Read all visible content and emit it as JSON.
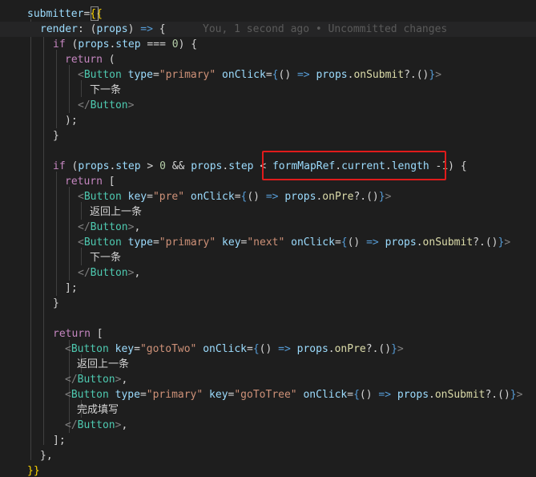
{
  "colors": {
    "background": "#1e1e1e",
    "text": "#d4d4d4",
    "property": "#9cdcfe",
    "keyword": "#c586c0",
    "storage": "#569cd6",
    "tag": "#4ec9b0",
    "tag_bracket": "#808080",
    "string": "#ce9178",
    "number": "#b5cea8",
    "function": "#dcdcaa",
    "brace": "#ffd700",
    "blame": "#5a5a5a",
    "annotation_box": "#e01b1b"
  },
  "editor": {
    "blame_annotation": "You, 1 second ago • Uncommitted changes",
    "lines": [
      [
        [
          "submitter",
          "p"
        ],
        [
          "=",
          "t"
        ],
        [
          "{",
          "g"
        ],
        [
          "{",
          "g"
        ]
      ],
      [
        [
          "render",
          "p"
        ],
        [
          ": (",
          "t"
        ],
        [
          "props",
          "p"
        ],
        [
          ") ",
          "t"
        ],
        [
          "=>",
          "s"
        ],
        [
          " {",
          "t"
        ]
      ],
      [
        [
          "if",
          "k"
        ],
        [
          " (",
          "t"
        ],
        [
          "props",
          "p"
        ],
        [
          ".",
          "t"
        ],
        [
          "step",
          "p"
        ],
        [
          " === ",
          "t"
        ],
        [
          "0",
          "n"
        ],
        [
          ") {",
          "t"
        ]
      ],
      [
        [
          "return",
          "k"
        ],
        [
          " (",
          "t"
        ]
      ],
      [
        [
          "<",
          "b"
        ],
        [
          "Button",
          "c"
        ],
        [
          " ",
          "t"
        ],
        [
          "type",
          "p"
        ],
        [
          "=",
          "t"
        ],
        [
          "\"primary\"",
          "r"
        ],
        [
          " ",
          "t"
        ],
        [
          "onClick",
          "p"
        ],
        [
          "=",
          "t"
        ],
        [
          "{",
          "s"
        ],
        [
          "() ",
          "t"
        ],
        [
          "=>",
          "s"
        ],
        [
          " ",
          "t"
        ],
        [
          "props",
          "p"
        ],
        [
          ".",
          "t"
        ],
        [
          "onSubmit",
          "f"
        ],
        [
          "?.()",
          "t"
        ],
        [
          "}",
          "s"
        ],
        [
          ">",
          "b"
        ]
      ],
      [
        [
          "下一条",
          "t"
        ]
      ],
      [
        [
          "</",
          "b"
        ],
        [
          "Button",
          "c"
        ],
        [
          ">",
          "b"
        ]
      ],
      [
        [
          ");",
          "t"
        ]
      ],
      [
        [
          "}",
          "t"
        ]
      ],
      [],
      [
        [
          "if",
          "k"
        ],
        [
          " (",
          "t"
        ],
        [
          "props",
          "p"
        ],
        [
          ".",
          "t"
        ],
        [
          "step",
          "p"
        ],
        [
          " > ",
          "t"
        ],
        [
          "0",
          "n"
        ],
        [
          " && ",
          "t"
        ],
        [
          "props",
          "p"
        ],
        [
          ".",
          "t"
        ],
        [
          "step",
          "p"
        ],
        [
          " < ",
          "t"
        ],
        [
          "formMapRef",
          "p"
        ],
        [
          ".",
          "t"
        ],
        [
          "current",
          "p"
        ],
        [
          ".",
          "t"
        ],
        [
          "length",
          "p"
        ],
        [
          " -",
          "t"
        ],
        [
          "1",
          "n"
        ],
        [
          ") {",
          "t"
        ]
      ],
      [
        [
          "return",
          "k"
        ],
        [
          " [",
          "t"
        ]
      ],
      [
        [
          "<",
          "b"
        ],
        [
          "Button",
          "c"
        ],
        [
          " ",
          "t"
        ],
        [
          "key",
          "p"
        ],
        [
          "=",
          "t"
        ],
        [
          "\"pre\"",
          "r"
        ],
        [
          " ",
          "t"
        ],
        [
          "onClick",
          "p"
        ],
        [
          "=",
          "t"
        ],
        [
          "{",
          "s"
        ],
        [
          "() ",
          "t"
        ],
        [
          "=>",
          "s"
        ],
        [
          " ",
          "t"
        ],
        [
          "props",
          "p"
        ],
        [
          ".",
          "t"
        ],
        [
          "onPre",
          "f"
        ],
        [
          "?.()",
          "t"
        ],
        [
          "}",
          "s"
        ],
        [
          ">",
          "b"
        ]
      ],
      [
        [
          "返回上一条",
          "t"
        ]
      ],
      [
        [
          "</",
          "b"
        ],
        [
          "Button",
          "c"
        ],
        [
          ">",
          "b"
        ],
        [
          ",",
          "t"
        ]
      ],
      [
        [
          "<",
          "b"
        ],
        [
          "Button",
          "c"
        ],
        [
          " ",
          "t"
        ],
        [
          "type",
          "p"
        ],
        [
          "=",
          "t"
        ],
        [
          "\"primary\"",
          "r"
        ],
        [
          " ",
          "t"
        ],
        [
          "key",
          "p"
        ],
        [
          "=",
          "t"
        ],
        [
          "\"next\"",
          "r"
        ],
        [
          " ",
          "t"
        ],
        [
          "onClick",
          "p"
        ],
        [
          "=",
          "t"
        ],
        [
          "{",
          "s"
        ],
        [
          "() ",
          "t"
        ],
        [
          "=>",
          "s"
        ],
        [
          " ",
          "t"
        ],
        [
          "props",
          "p"
        ],
        [
          ".",
          "t"
        ],
        [
          "onSubmit",
          "f"
        ],
        [
          "?.()",
          "t"
        ],
        [
          "}",
          "s"
        ],
        [
          ">",
          "b"
        ]
      ],
      [
        [
          "下一条",
          "t"
        ]
      ],
      [
        [
          "</",
          "b"
        ],
        [
          "Button",
          "c"
        ],
        [
          ">",
          "b"
        ],
        [
          ",",
          "t"
        ]
      ],
      [
        [
          "];",
          "t"
        ]
      ],
      [
        [
          "}",
          "t"
        ]
      ],
      [],
      [
        [
          "return",
          "k"
        ],
        [
          " [",
          "t"
        ]
      ],
      [
        [
          "<",
          "b"
        ],
        [
          "Button",
          "c"
        ],
        [
          " ",
          "t"
        ],
        [
          "key",
          "p"
        ],
        [
          "=",
          "t"
        ],
        [
          "\"gotoTwo\"",
          "r"
        ],
        [
          " ",
          "t"
        ],
        [
          "onClick",
          "p"
        ],
        [
          "=",
          "t"
        ],
        [
          "{",
          "s"
        ],
        [
          "() ",
          "t"
        ],
        [
          "=>",
          "s"
        ],
        [
          " ",
          "t"
        ],
        [
          "props",
          "p"
        ],
        [
          ".",
          "t"
        ],
        [
          "onPre",
          "f"
        ],
        [
          "?.()",
          "t"
        ],
        [
          "}",
          "s"
        ],
        [
          ">",
          "b"
        ]
      ],
      [
        [
          "返回上一条",
          "t"
        ]
      ],
      [
        [
          "</",
          "b"
        ],
        [
          "Button",
          "c"
        ],
        [
          ">",
          "b"
        ],
        [
          ",",
          "t"
        ]
      ],
      [
        [
          "<",
          "b"
        ],
        [
          "Button",
          "c"
        ],
        [
          " ",
          "t"
        ],
        [
          "type",
          "p"
        ],
        [
          "=",
          "t"
        ],
        [
          "\"primary\"",
          "r"
        ],
        [
          " ",
          "t"
        ],
        [
          "key",
          "p"
        ],
        [
          "=",
          "t"
        ],
        [
          "\"goToTree\"",
          "r"
        ],
        [
          " ",
          "t"
        ],
        [
          "onClick",
          "p"
        ],
        [
          "=",
          "t"
        ],
        [
          "{",
          "s"
        ],
        [
          "() ",
          "t"
        ],
        [
          "=>",
          "s"
        ],
        [
          " ",
          "t"
        ],
        [
          "props",
          "p"
        ],
        [
          ".",
          "t"
        ],
        [
          "onSubmit",
          "f"
        ],
        [
          "?.()",
          "t"
        ],
        [
          "}",
          "s"
        ],
        [
          ">",
          "b"
        ]
      ],
      [
        [
          "完成填写",
          "t"
        ]
      ],
      [
        [
          "</",
          "b"
        ],
        [
          "Button",
          "c"
        ],
        [
          ">",
          "b"
        ],
        [
          ",",
          "t"
        ]
      ],
      [
        [
          "];",
          "t"
        ]
      ],
      [
        [
          "},",
          "t"
        ]
      ],
      [
        [
          "}}",
          "g"
        ]
      ]
    ]
  }
}
